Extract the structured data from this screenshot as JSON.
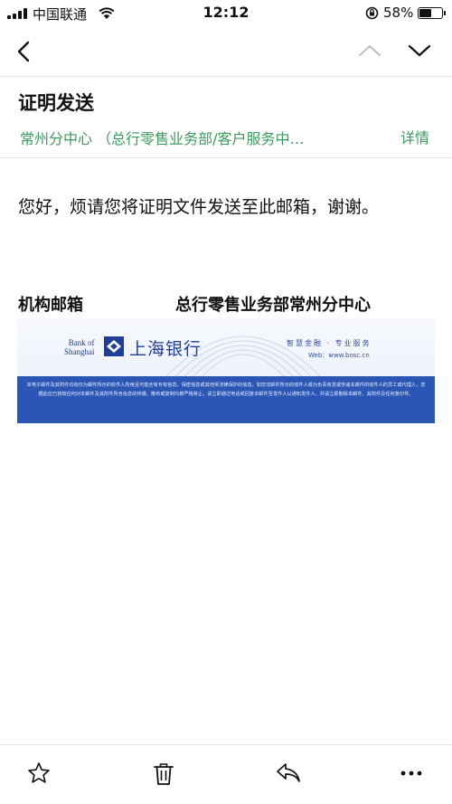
{
  "status_bar": {
    "carrier": "中国联通",
    "time": "12:12",
    "battery_percent": "58%",
    "battery_level": 0.58
  },
  "nav": {
    "back_icon": "chevron-left-icon",
    "prev_icon": "chevron-up-icon",
    "next_icon": "chevron-down-icon"
  },
  "mail": {
    "subject": "证明发送",
    "sender": "常州分中心 （总行零售业务部/客户服务中…",
    "detail_link": "详情",
    "body": "您好，烦请您将证明文件发送至此邮箱，谢谢。",
    "signature_label": "机构邮箱",
    "signature_dept": "总行零售业务部常州分中心"
  },
  "banner": {
    "bank_name_en_line1": "Bank of",
    "bank_name_en_line2": "Shanghai",
    "bank_name_cn": "上海银行",
    "slogan": "智慧金融 · 专业服务",
    "website": "Web：www.bosc.cn",
    "disclaimer": "本电子邮件及其附件均有仅为邮件所示的收件人所用且可能含有专有信息，保密信息或其他受法律保护的信息。如您非邮件所示的收件人或为负责收发或传递本邮件的收件人的员工或代理人，您据此应已获知任何对本邮件及其附件所含信息的传播、散布或复制均被严格禁止。请立即通过电话或回复本邮件至发件人以通知发件人，并请立即删除本邮件、其附件及任何复印件。"
  },
  "toolbar": {
    "icons": [
      "star-icon",
      "trash-icon",
      "reply-icon",
      "more-icon"
    ]
  },
  "colors": {
    "accent_green": "#3d9a5e",
    "bank_blue": "#2c56b4"
  }
}
